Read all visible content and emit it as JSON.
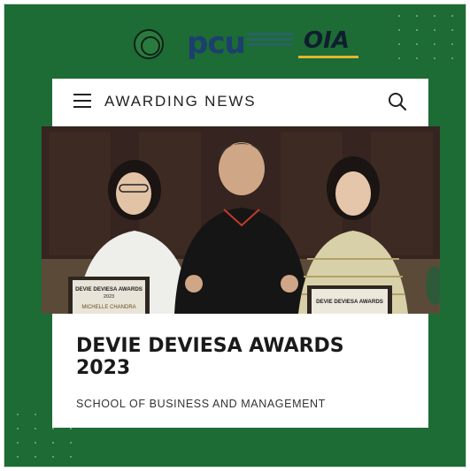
{
  "brand": {
    "pcu_logo_text": "pcu",
    "oia_logo_text": "OIA",
    "colors": {
      "background": "#1d6b35",
      "card": "#ffffff",
      "oia_accent": "#e2b531",
      "pcu_blue": "#1b3f6e"
    }
  },
  "header": {
    "title": "AWARDING NEWS",
    "menu_icon": "hamburger-menu-icon",
    "search_icon": "search-icon"
  },
  "photo": {
    "certificate_left_title": "DEVIE DEVIESA AWARDS",
    "certificate_left_year": "2023",
    "certificate_left_name": "MICHELLE CHANDRA",
    "certificate_right_title": "DEVIE DEVIESA AWARDS"
  },
  "article": {
    "headline_line1": "DEVIE DEVIESA AWARDS",
    "headline_line2": "2023",
    "school": "SCHOOL OF BUSINESS AND MANAGEMENT"
  }
}
